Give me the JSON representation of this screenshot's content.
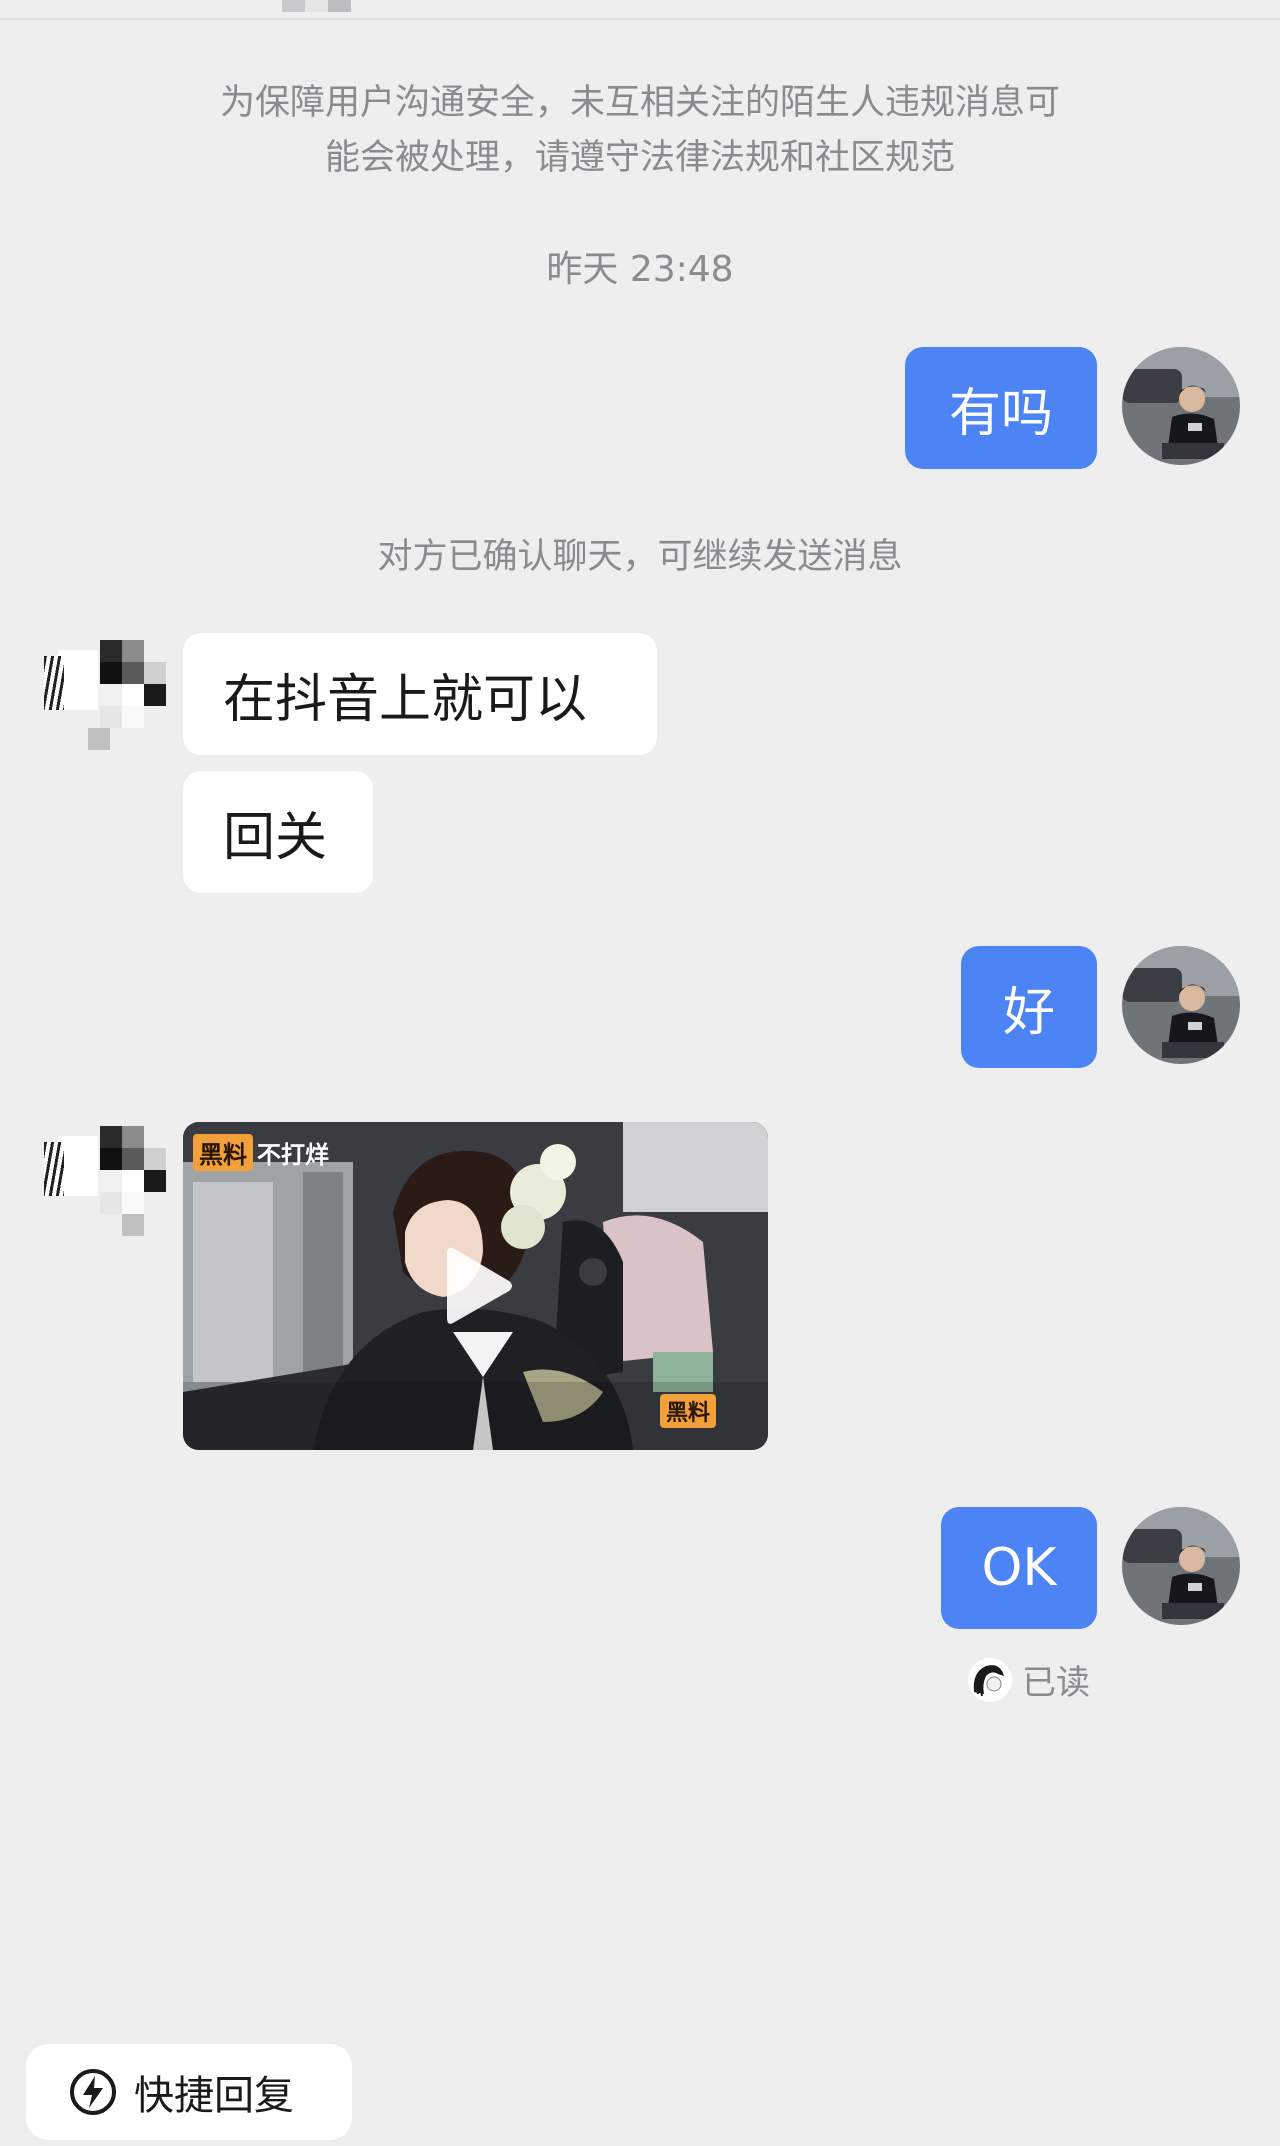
{
  "notice": {
    "line1": "为保障用户沟通安全，未互相关注的陌生人违规消息可",
    "line2": "能会被处理，请遵守法律法规和社区规范"
  },
  "timestamp": "昨天 23:48",
  "system_message": "对方已确认聊天，可继续发送消息",
  "messages": [
    {
      "side": "out",
      "text": "有吗"
    },
    {
      "side": "in",
      "text": "在抖音上就可以"
    },
    {
      "side": "in",
      "text": "回关"
    },
    {
      "side": "out",
      "text": "好"
    },
    {
      "side": "in",
      "type": "video",
      "tag_badge": "黑料",
      "tag_text": "不打烊",
      "corner_badge": "黑料"
    },
    {
      "side": "out",
      "text": "OK"
    }
  ],
  "read_status": "已读",
  "quick_reply": {
    "label": "快捷回复",
    "icon": "lightning-icon"
  },
  "colors": {
    "outgoing_bubble": "#4c83f5",
    "incoming_bubble": "#ffffff",
    "background": "#eeeeef"
  }
}
